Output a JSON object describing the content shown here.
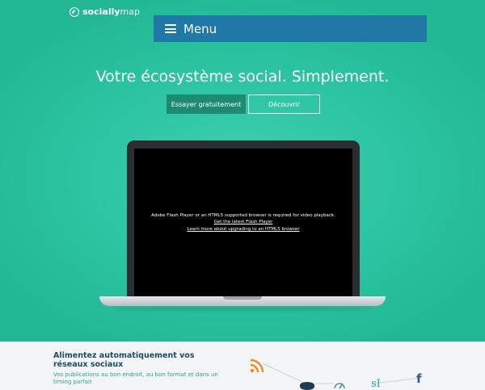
{
  "header": {
    "logo_bold": "socially",
    "logo_light": "map",
    "menu_label": "Menu"
  },
  "hero": {
    "headline": "Votre écosystème social. Simplement.",
    "try_button": "Essayer gratuitement",
    "discover_button": "Découvrir"
  },
  "video": {
    "message": "Adobe Flash Player or an HTML5 supported browser is required for video playback.",
    "link_flash": "Get the latest Flash Player",
    "link_html5": "Learn more about upgrading to an HTML5 browser"
  },
  "features": {
    "title": "Alimentez automatiquement vos réseaux sociaux",
    "subtitle": "Vos publications au bon endroit, au bon format et dans un timing parfait",
    "icons": [
      "rss-icon",
      "database-icon",
      "gauge-icon",
      "social-icon",
      "facebook-icon"
    ]
  },
  "colors": {
    "hero_bg": "#2cc4a2",
    "menu_bg": "#1f78a6",
    "try_button_bg": "#1d8a72",
    "feature_title": "#1f4a66",
    "feature_subtitle": "#2ca58c"
  }
}
